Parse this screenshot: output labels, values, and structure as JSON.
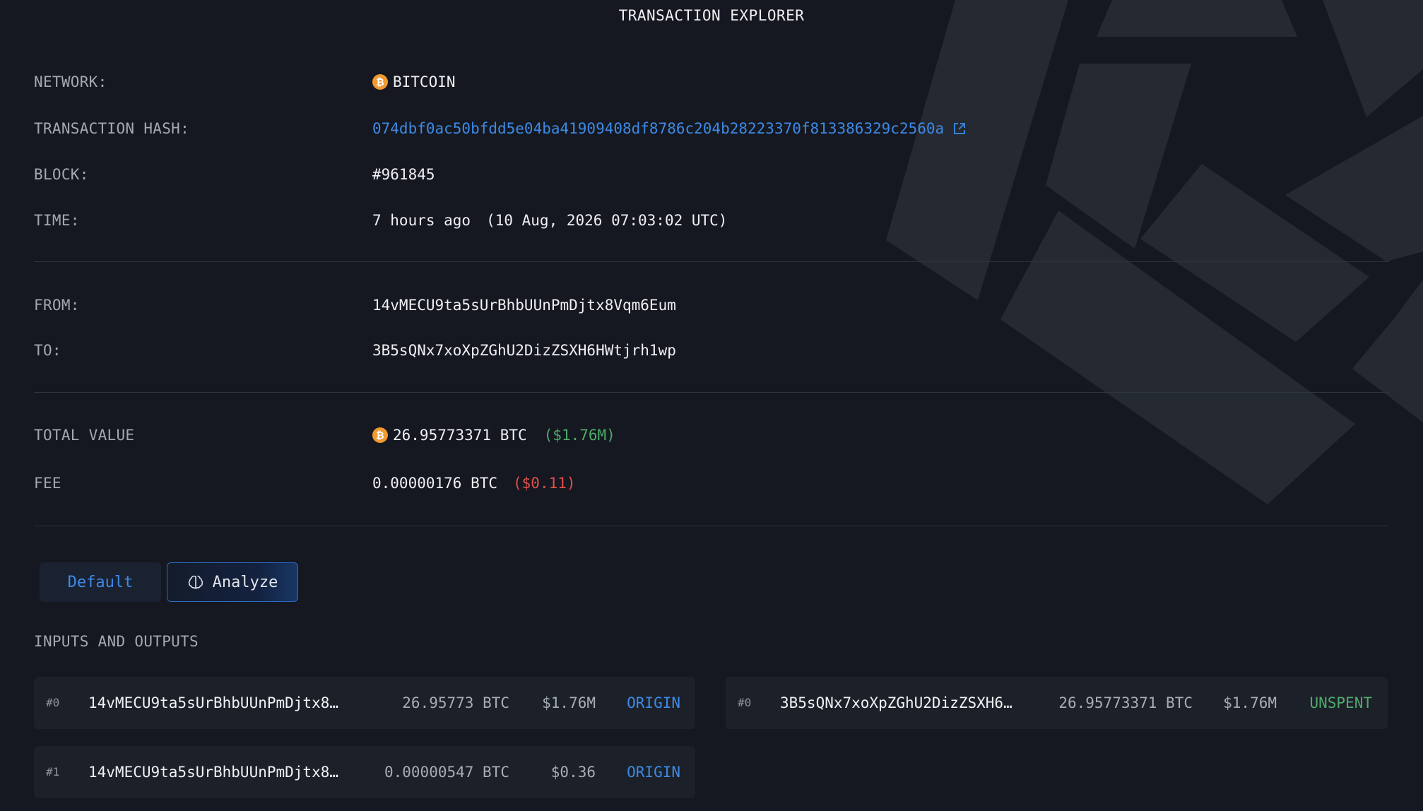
{
  "title": "TRANSACTION EXPLORER",
  "details": {
    "network_label": "NETWORK:",
    "network_value": "BITCOIN",
    "hash_label": "TRANSACTION HASH:",
    "hash_value": "074dbf0ac50bfdd5e04ba41909408df8786c204b28223370f813386329c2560a",
    "block_label": "BLOCK:",
    "block_value": "#961845",
    "time_label": "TIME:",
    "time_relative": "7 hours ago",
    "time_absolute": "(10 Aug, 2026 07:03:02 UTC)"
  },
  "parties": {
    "from_label": "FROM:",
    "from_value": "14vMECU9ta5sUrBhbUUnPmDjtx8Vqm6Eum",
    "to_label": "TO:",
    "to_value": "3B5sQNx7xoXpZGhU2DizZSXH6HWtjrh1wp"
  },
  "amounts": {
    "total_label": "TOTAL VALUE",
    "total_value": "26.95773371 BTC",
    "total_usd": "($1.76M)",
    "fee_label": "FEE",
    "fee_value": "0.00000176 BTC",
    "fee_usd": "($0.11)"
  },
  "tabs": {
    "default_label": "Default",
    "analyze_label": "Analyze",
    "active": "Analyze"
  },
  "io": {
    "title": "INPUTS AND OUTPUTS",
    "inputs": [
      {
        "index": "#0",
        "address": "14vMECU9ta5sUrBhbUUnPmDjtx8…",
        "amount": "26.95773 BTC",
        "usd": "$1.76M",
        "status": "ORIGIN"
      },
      {
        "index": "#1",
        "address": "14vMECU9ta5sUrBhbUUnPmDjtx8…",
        "amount": "0.00000547 BTC",
        "usd": "$0.36",
        "status": "ORIGIN"
      }
    ],
    "outputs": [
      {
        "index": "#0",
        "address": "3B5sQNx7xoXpZGhU2DizZSXH6…",
        "amount": "26.95773371 BTC",
        "usd": "$1.76M",
        "status": "UNSPENT"
      }
    ]
  },
  "icons": {
    "network": "bitcoin-icon",
    "hash_link": "external-link-icon",
    "analyze": "brain-icon"
  },
  "colors": {
    "background": "#151820",
    "link_blue": "#3d8ae6",
    "positive_green": "#4eaa6a",
    "negative_red": "#e0504e",
    "bitcoin_orange": "#f29a30"
  }
}
